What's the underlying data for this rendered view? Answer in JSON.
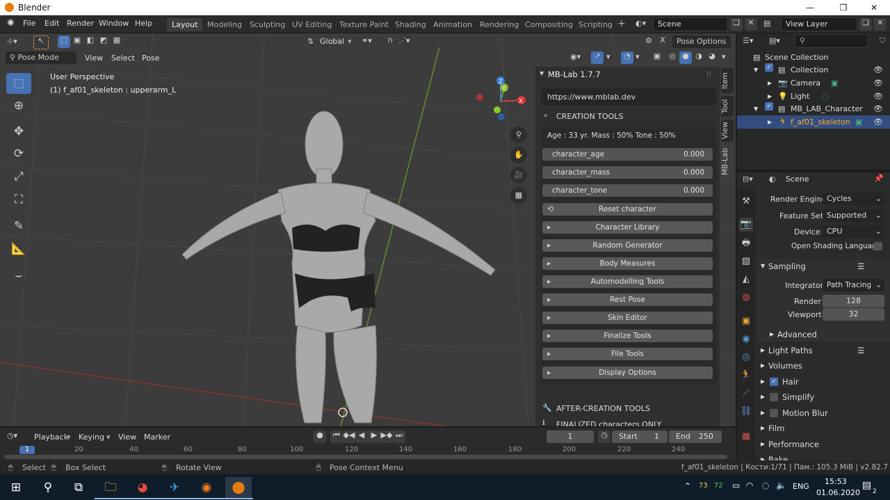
{
  "window": {
    "title": "Blender"
  },
  "menu": [
    "File",
    "Edit",
    "Render",
    "Window",
    "Help"
  ],
  "workspaces": [
    "Layout",
    "Modeling",
    "Sculpting",
    "UV Editing",
    "Texture Paint",
    "Shading",
    "Animation",
    "Rendering",
    "Compositing",
    "Scripting"
  ],
  "scene_field": "Scene",
  "view_layer_field": "View Layer",
  "viewport": {
    "mode": "Pose Mode",
    "menus": [
      "View",
      "Select",
      "Pose"
    ],
    "transform_orientation": "Global",
    "pose_options": "Pose Options",
    "overlay_line1": "User Perspective",
    "overlay_line2": "(1) f_af01_skeleton : upperarm_L",
    "gizmo_axes": [
      "X",
      "Y",
      "Z"
    ]
  },
  "npanel": {
    "title": "MB-Lab 1.7.7",
    "url": "https://www.mblab.dev",
    "creation_header": "CREATION TOOLS",
    "summary": "Age : 33 yr.  Mass : 50%  Tone : 50%",
    "sliders": [
      {
        "label": "character_age",
        "value": "0.000"
      },
      {
        "label": "character_mass",
        "value": "0.000"
      },
      {
        "label": "character_tone",
        "value": "0.000"
      }
    ],
    "reset": "Reset character",
    "panels": [
      "Character Library",
      "Random Generator",
      "Body Measures",
      "Automodelling Tools",
      "Rest Pose",
      "Skin Editor",
      "Finalize Tools",
      "File Tools",
      "Display Options"
    ],
    "after_header": "AFTER-CREATION TOOLS",
    "finalized_note": "FINALIZED characters ONLY",
    "tabs": [
      "Item",
      "Tool",
      "View",
      "MB-Lab"
    ]
  },
  "outliner": {
    "search_placeholder": "",
    "rows": [
      {
        "label": "Scene Collection"
      },
      {
        "label": "Collection"
      },
      {
        "label": "Camera"
      },
      {
        "label": "Light"
      },
      {
        "label": "MB_LAB_Character"
      },
      {
        "label": "f_af01_skeleton"
      }
    ]
  },
  "properties": {
    "context": "Scene",
    "render_engine_label": "Render Engine",
    "render_engine": "Cycles",
    "feature_set_label": "Feature Set",
    "feature_set": "Supported",
    "device_label": "Device",
    "device": "CPU",
    "osl_label": "Open Shading Language",
    "sampling": "Sampling",
    "integrator_label": "Integrator",
    "integrator": "Path Tracing",
    "render_label": "Render",
    "render_samples": "128",
    "viewport_label": "Viewport",
    "viewport_samples": "32",
    "advanced": "Advanced",
    "sections": [
      "Light Paths",
      "Volumes",
      "Hair",
      "Simplify",
      "Motion Blur",
      "Film",
      "Performance",
      "Bake"
    ],
    "hair_checked": true
  },
  "timeline": {
    "menus": [
      "Playback",
      "Keying",
      "View",
      "Marker"
    ],
    "current_frame": "1",
    "start_label": "Start",
    "start": "1",
    "end_label": "End",
    "end": "250",
    "ruler": [
      "1",
      "20",
      "40",
      "60",
      "80",
      "100",
      "120",
      "140",
      "160",
      "180",
      "200",
      "220",
      "240"
    ]
  },
  "status": {
    "select": "Select",
    "box_select": "Box Select",
    "rotate_view": "Rotate View",
    "context_menu": "Pose Context Menu",
    "info": "f_af01_skeleton | Кости:1/71 | Пам.: 105.3 MiB | v2.82.7"
  },
  "taskbar": {
    "temp1": "73",
    "temp2": "72",
    "lang": "ENG",
    "time": "15:53",
    "date": "01.06.2020",
    "notify_count": "2"
  }
}
